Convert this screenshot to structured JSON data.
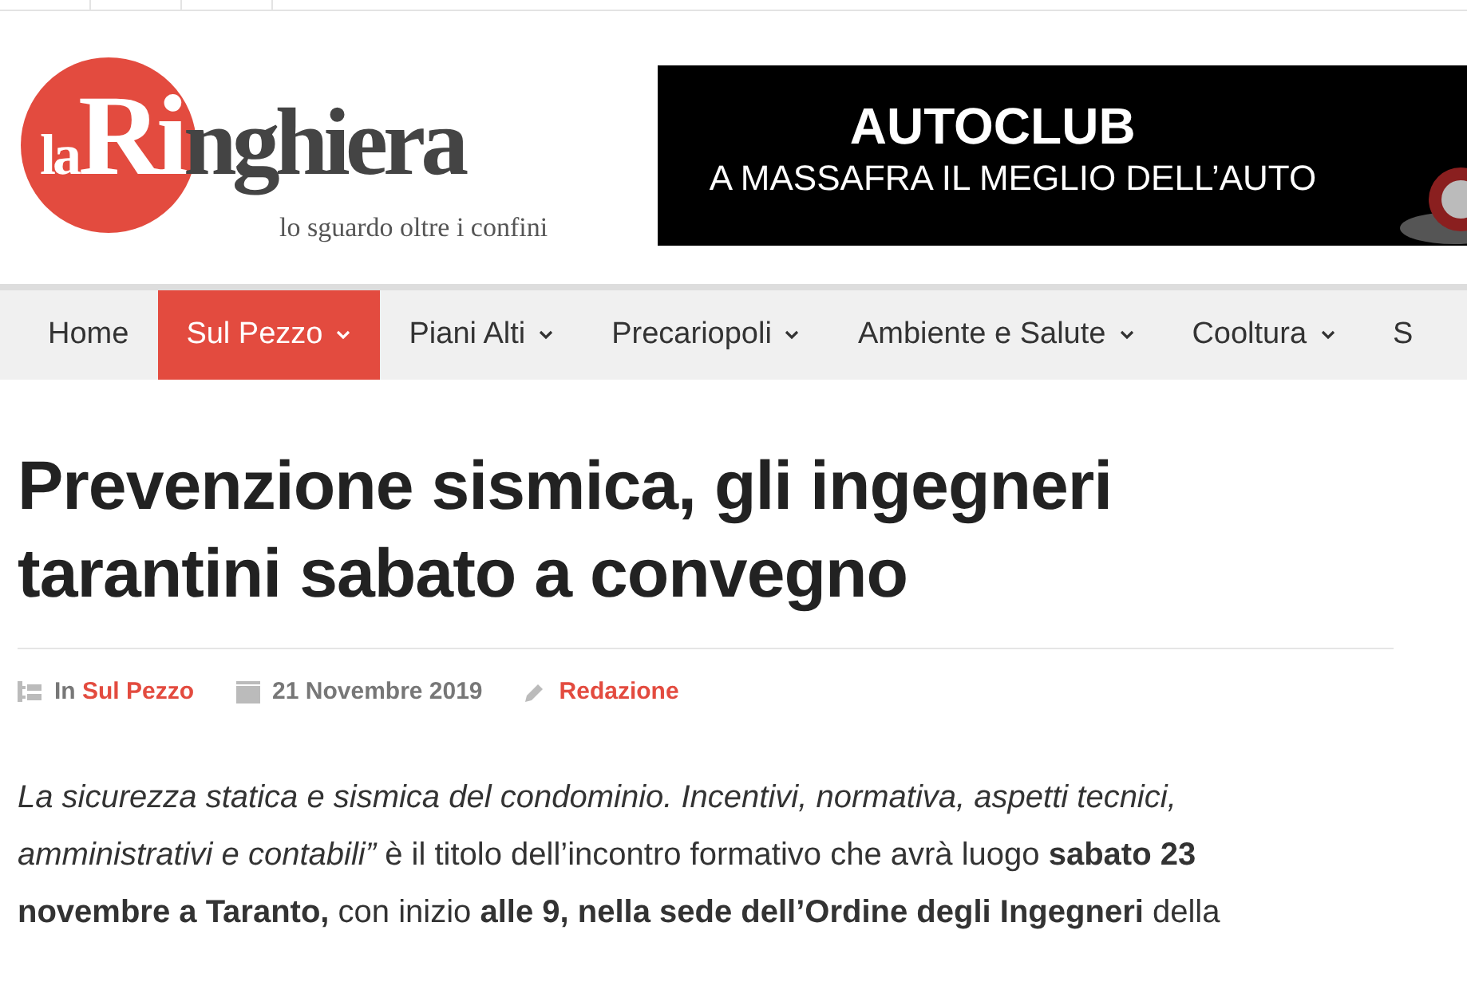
{
  "logo": {
    "prefix": "la",
    "initial": "Ri",
    "rest": "nghiera",
    "tagline": "lo sguardo oltre i confini"
  },
  "banner": {
    "title": "AUTOCLUB",
    "subtitle": "A MASSAFRA IL MEGLIO DELL’AUTO"
  },
  "nav": [
    {
      "label": "Home",
      "selected": false,
      "dropdown": false
    },
    {
      "label": "Sul Pezzo",
      "selected": true,
      "dropdown": true
    },
    {
      "label": "Piani Alti",
      "selected": false,
      "dropdown": true
    },
    {
      "label": "Precariopoli",
      "selected": false,
      "dropdown": true
    },
    {
      "label": "Ambiente e Salute",
      "selected": false,
      "dropdown": true
    },
    {
      "label": "Cooltura",
      "selected": false,
      "dropdown": true
    },
    {
      "label": "S",
      "selected": false,
      "dropdown": false
    }
  ],
  "article": {
    "title": "Prevenzione sismica, gli ingegneri tarantini sabato a convegno",
    "meta": {
      "in_label": "In",
      "category": "Sul Pezzo",
      "date": "21 Novembre 2019",
      "author": "Redazione"
    },
    "body": "*La sicurezza statica e sismica del condominio. Incentivi, normativa, aspetti tecnici, amministrativi e contabili”* è il titolo dell’incontro formativo che avrà luogo **sabato 23 novembre a Taranto,** con inizio **alle 9, nella sede dell’Ordine degli Ingegneri** della"
  }
}
